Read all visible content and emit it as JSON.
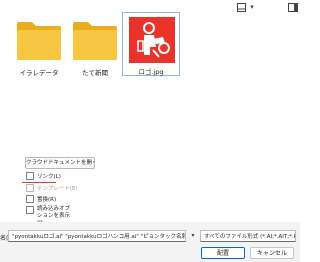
{
  "toolbar": {
    "view_icon": "view-options-icon",
    "chevron": "▾",
    "help_icon": "help-pane-icon"
  },
  "files": [
    {
      "name": "イラレデータ",
      "type": "folder"
    },
    {
      "name": "たて新聞",
      "type": "folder"
    },
    {
      "name": "ロゴ.jpg",
      "type": "image",
      "selected": true
    }
  ],
  "options": {
    "cloud_button": "クラウドドキュメントを開く(C)",
    "link": "リンク(L)",
    "template": "テンプレート(E)",
    "replace": "置換(R)",
    "show_import_options": "読み込みオプションを表示(I)"
  },
  "bottom": {
    "filename_label": "名(N):",
    "filename_value": "\"pyontakkuロゴ.ai\" \"pyontakkuロゴハンコ用.ai\" \"ピョンタック名刺.ai\"",
    "filetype_value": "すべてのファイル形式 (*.AI;*.AIT;*.PI",
    "place_button": "配置",
    "cancel_button": "キャンセル"
  },
  "colors": {
    "folder": "#f7c744",
    "folder_back": "#e9ad1e",
    "logo_red": "#e9332b",
    "accent": "#0067c0",
    "annotation_red": "#e53935"
  }
}
